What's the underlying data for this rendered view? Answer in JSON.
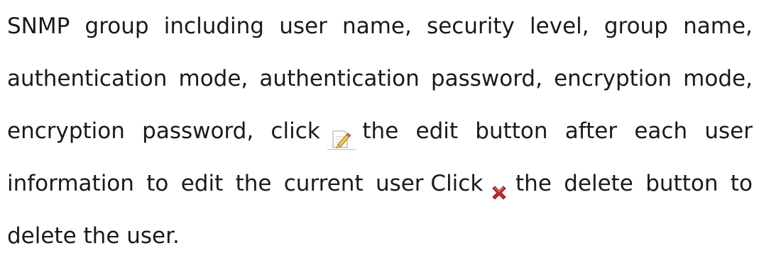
{
  "paragraph": {
    "line1": [
      "SNMP",
      "group",
      "including",
      "user",
      "name,",
      "security",
      "level,",
      "group",
      "name,"
    ],
    "line2": [
      "authentication",
      "mode,",
      "authentication",
      "password,",
      "encryption",
      "mode,"
    ],
    "line3_before_icon": [
      "encryption",
      "password,",
      "click"
    ],
    "line3_after_icon": [
      "the",
      "edit",
      "button",
      "after",
      "each",
      "user"
    ],
    "line4_before_icon": [
      "information",
      "to",
      "edit",
      "the",
      "current",
      "user",
      "Click"
    ],
    "line4_after_icon": [
      "the",
      "delete",
      "button",
      "to"
    ],
    "line5": "delete the user."
  },
  "icons": {
    "edit": "edit-pencil-icon",
    "delete": "delete-x-icon"
  },
  "colors": {
    "text": "#1a1a1a",
    "delete_red": "#c62828",
    "pencil_yellow": "#f2c94c"
  }
}
